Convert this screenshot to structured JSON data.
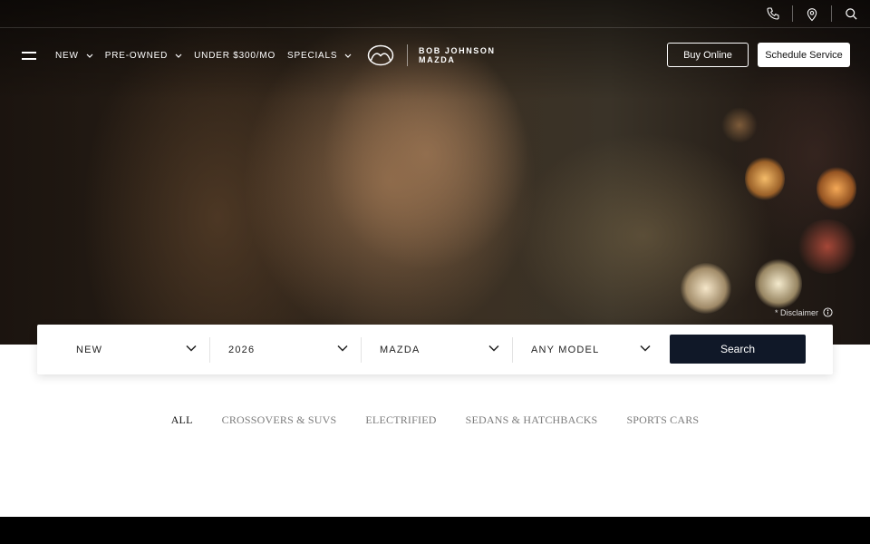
{
  "nav": {
    "items": [
      {
        "label": "NEW",
        "has_dropdown": true
      },
      {
        "label": "PRE-OWNED",
        "has_dropdown": true
      },
      {
        "label": "UNDER $300/MO",
        "has_dropdown": false
      },
      {
        "label": "SPECIALS",
        "has_dropdown": true
      }
    ],
    "logo_line1": "BOB JOHNSON",
    "logo_line2": "MAZDA",
    "buy_online_label": "Buy Online",
    "schedule_service_label": "Schedule Service"
  },
  "utility": {
    "icons": [
      "phone-icon",
      "location-pin-icon",
      "search-icon"
    ]
  },
  "hero": {
    "disclaimer_label": "* Disclaimer"
  },
  "search": {
    "condition": "NEW",
    "year": "2026",
    "make": "MAZDA",
    "model": "ANY MODEL",
    "button_label": "Search"
  },
  "tabs": [
    {
      "label": "ALL",
      "active": true
    },
    {
      "label": "CROSSOVERS & SUVS",
      "active": false
    },
    {
      "label": "ELECTRIFIED",
      "active": false
    },
    {
      "label": "SEDANS & HATCHBACKS",
      "active": false
    },
    {
      "label": "SPORTS CARS",
      "active": false
    }
  ],
  "colors": {
    "accent": "#101828",
    "footer": "#000000"
  }
}
